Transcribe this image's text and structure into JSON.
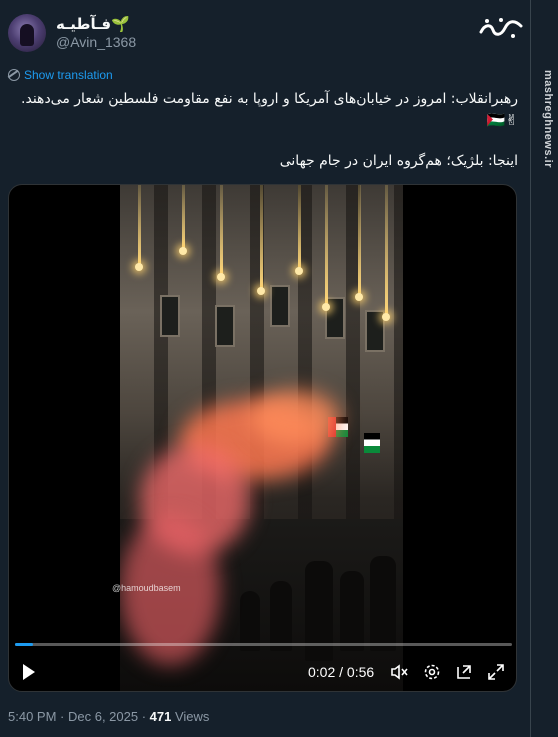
{
  "tweet": {
    "display_name": "فـآطیـه",
    "sprout_icon": "🌱",
    "handle": "@Avin_1368",
    "show_translation": "Show translation",
    "text_line1": "رهبرانقلاب: امروز در خیابان‌های آمریکا و اروپا به نفع مقاومت فلسطین شعار می‌دهند.",
    "text_line2_emoji": "✌🇵🇸",
    "text_line3": "اینجا: بلژیک؛ هم‌گروه ایران در جام جهانی",
    "time": "5:40 PM",
    "date": "Dec 6, 2025",
    "views_count": "471",
    "views_label": "Views"
  },
  "video": {
    "watermark": "@hamoudbasem",
    "current_time": "0:02",
    "duration": "0:56",
    "progress": 0.036
  },
  "branding": {
    "logo_text": "مشرق",
    "vertical_url": "mashreghnews.ir"
  },
  "colors": {
    "background": "#15202b",
    "accent": "#1d9bf0",
    "muted": "#8b98a5"
  }
}
